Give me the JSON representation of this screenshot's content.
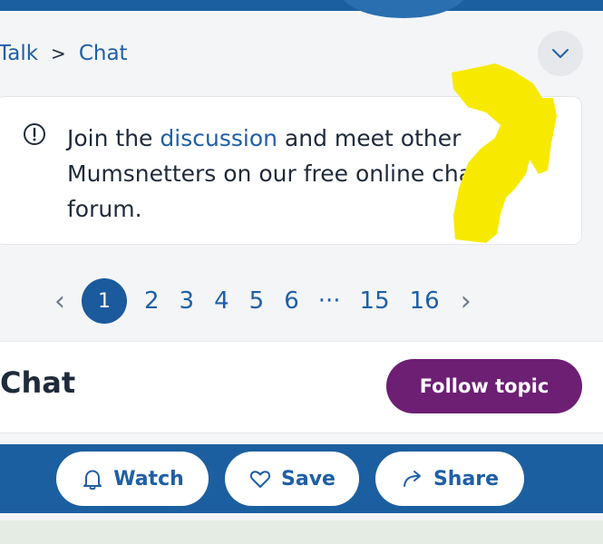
{
  "breadcrumb": {
    "items": [
      "Talk",
      "Chat"
    ],
    "separator": ">"
  },
  "info": {
    "before_link": "Join the ",
    "link": "discussion",
    "after_link": " and meet other Mumsnetters on our free online chat forum."
  },
  "pager": {
    "prev_symbol": "‹",
    "next_symbol": "›",
    "current": "1",
    "pages": [
      "2",
      "3",
      "4",
      "5",
      "6"
    ],
    "ellipsis": "···",
    "last_pages": [
      "15",
      "16"
    ]
  },
  "topic": {
    "title": "Chat",
    "follow_label": "Follow topic"
  },
  "actions": {
    "watch": "Watch",
    "save": "Save",
    "share": "Share"
  },
  "colors": {
    "brand_blue": "#1c5fa0",
    "link_blue": "#1f5fa6",
    "follow_purple": "#6d1f74",
    "highlight_yellow": "#f7ea00"
  },
  "icons": [
    "chevron-down-icon",
    "info-icon",
    "bell-icon",
    "heart-icon",
    "share-arrow-icon"
  ]
}
